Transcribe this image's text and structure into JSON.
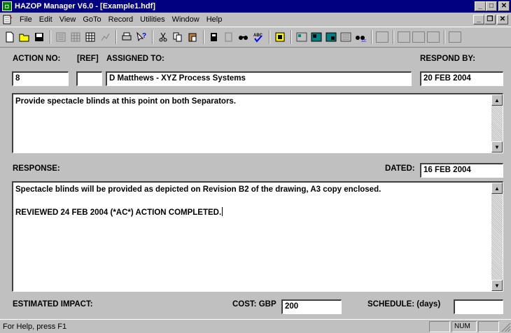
{
  "window": {
    "title": "HAZOP Manager V6.0 - [Example1.hdf]",
    "minimize_label": "_",
    "maximize_label": "□",
    "close_label": "✕"
  },
  "menu": {
    "items": [
      "File",
      "Edit",
      "View",
      "GoTo",
      "Record",
      "Utilities",
      "Window",
      "Help"
    ]
  },
  "toolbar": {
    "icons": [
      "new-icon",
      "open-icon",
      "save-icon",
      "report-icon",
      "table-icon",
      "grid-icon",
      "chart-icon",
      "print-icon",
      "help-pointer-icon",
      "cut-icon",
      "copy-icon",
      "paste-icon",
      "book-icon",
      "book2-icon",
      "find-icon",
      "spellcheck-icon",
      "record-icon",
      "view1-icon",
      "view2-icon",
      "view3-icon",
      "view4-icon",
      "binoculars-icon"
    ]
  },
  "form": {
    "action_no_label": "ACTION NO:",
    "ref_label": "[REF]",
    "assigned_to_label": "ASSIGNED TO:",
    "respond_by_label": "RESPOND BY:",
    "action_no_value": "8",
    "ref_value": "",
    "assigned_to_value": "D Matthews - XYZ Process Systems",
    "respond_by_value": "20 FEB 2004",
    "action_text": "Provide spectacle blinds at this point on both Separators.",
    "response_label": "RESPONSE:",
    "dated_label": "DATED:",
    "dated_value": "16 FEB 2004",
    "response_line1": "Spectacle blinds will be provided as depicted on Revision B2 of the drawing, A3 copy enclosed.",
    "response_line2": "REVIEWED 24 FEB 2004 (*AC*) ACTION COMPLETED.",
    "estimated_impact_label": "ESTIMATED IMPACT:",
    "cost_label": "COST: GBP",
    "cost_value": "200",
    "schedule_label": "SCHEDULE: (days)",
    "schedule_value": ""
  },
  "status": {
    "help_text": "For Help, press F1",
    "num_indicator": "NUM"
  }
}
